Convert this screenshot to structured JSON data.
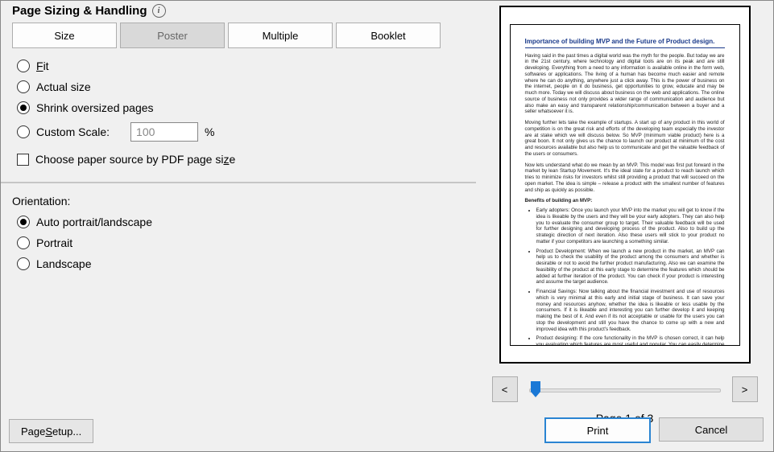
{
  "sizing": {
    "title": "Page Sizing & Handling",
    "tabs": {
      "size": "Size",
      "poster": "Poster",
      "multiple": "Multiple",
      "booklet": "Booklet"
    },
    "radios": {
      "fit": "Fit",
      "actual": "Actual size",
      "shrink": "Shrink oversized pages",
      "custom_label": "Custom Scale:",
      "custom_value": "100"
    },
    "percent": "%",
    "paper_source": "Choose paper source by PDF page size"
  },
  "orientation": {
    "title": "Orientation:",
    "auto": "Auto portrait/landscape",
    "portrait": "Portrait",
    "landscape": "Landscape"
  },
  "page_setup": "Page Setup...",
  "nav": {
    "prev": "<",
    "next": ">"
  },
  "page_indicator": "Page 1 of 3",
  "actions": {
    "print": "Print",
    "cancel": "Cancel"
  },
  "preview": {
    "title": "Importance of building MVP and the Future of Product design.",
    "p1": "Having said in the past times a digital world was the myth for the people. But today we are in the 21st century, where technology and digital tools are on its peak and are still developing. Everything from a need to any information is available online in the form web, softwares or applications. The living of a human has become much easier and remote where he can do anything, anywhere just a click away. This is the power of business on the internet, people on it do business, get opportunities to grow, educate and may be much more. Today we will discuss about business on the web and applications. The online source of business not only provides a wider range of communication and audience but also make an easy and transparent relationship/communication between a buyer and a seller whatsoever it is.",
    "p2": "Moving further lets take the example of startups. A start up of any product in this world of competition is on the great risk and efforts of the developing team especially the investor are at stake which we will discuss below. So MVP (minimum viable product) here is a great boon. It not only gives us the chance to launch our product at minimum of the cost and resources available but also help us to communicate and get the valuable feedback of the users or consumers.",
    "p3": "Now lets understand what do we mean by an MVP. This model was first put forward in the market by lean Startup Movement. It's the ideal state for a product to reach launch which tries to minimize risks for investors whilst still providing a product that will succeed on the open market. The idea is simple – release a product with the smallest number of features and ship as quickly as possible.",
    "sub1": "Benefits of building an MVP:",
    "b1": "Early adopters: Once you launch your MVP into the market you will get to know if the idea is likeable by the users and they will be your early adopters. They can also help you to evaluate the consumer group to target. Their valuable feedback will be used for further designing and developing process of the product. Also to build up the strategic direction of next iteration. Also these users will stick to your product no matter if your competitors are launching a something similar.",
    "b2": "Product Development: When we launch a new product in the market, an MVP can help us to check the usability of the product among the consumers and whether is desirable or not to avoid the further product manufacturing. Also we can examine the feasibility of the product at this early stage to determine the features which should be added at further iteration of the product. You can check if your product is interesting and assume the target audience.",
    "b3": "Financial Savings: Now talking about the financial investment and use of resources which is very minimal at this early and initial stage of business. It can save your money and resources anyhow, whether the idea is likeable or less usable by the consumers. If it is likeable and interesting you can further develop it and keeping making the best of it. And even if its not acceptable or usable for the users you can stop the development and still you have the chance to come up with a new and improved idea with this product's feedback.",
    "b4": "Product designing: If the core functionality in the MVP is chosen correct, it can help you evaluating which features are most useful and popular. You can easily determine through the feedbacks, the faults and other drawbacks, if any and can solve them at this early stage."
  }
}
